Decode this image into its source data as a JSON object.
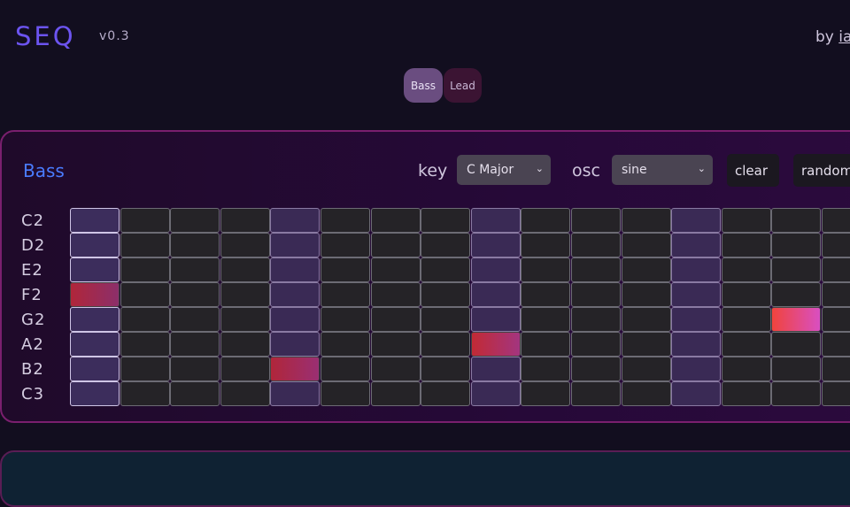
{
  "header": {
    "logo": "SEQ",
    "version": "v0.3",
    "byline": "by ",
    "byline_link": "ia"
  },
  "tabs": [
    {
      "label": "Bass"
    },
    {
      "label": "Lead"
    }
  ],
  "panel": {
    "title": "Bass",
    "key_label": "key",
    "key_value": "C Major",
    "osc_label": "osc",
    "osc_value": "sine",
    "clear_label": "clear",
    "random_label": "random",
    "notes": [
      "C2",
      "D2",
      "E2",
      "F2",
      "G2",
      "A2",
      "B2",
      "C3"
    ],
    "steps_visible": 16,
    "active_steps": [
      {
        "note": "F2",
        "step": 1,
        "colors": [
          "#b0263a",
          "#8c2f6a"
        ]
      },
      {
        "note": "B2",
        "step": 5,
        "colors": [
          "#b0263a",
          "#9a2f73"
        ]
      },
      {
        "note": "A2",
        "step": 9,
        "colors": [
          "#c22a35",
          "#a3357f"
        ]
      },
      {
        "note": "G2",
        "step": 15,
        "colors": [
          "#f0443c",
          "#d94fc2"
        ]
      }
    ]
  }
}
